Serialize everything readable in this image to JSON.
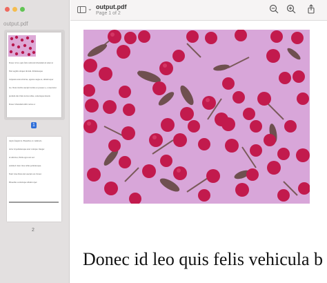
{
  "window": {
    "title": "output.pdf",
    "subtitle": "Page 1 of 2"
  },
  "sidebar": {
    "title": "output.pdf",
    "selected_page_label": "1",
    "page2_label": "2",
    "thumb1_lines": [
      "Donec id leo quis felis vehicula bibendum sit amet ut",
      "Nisl sagittis aliquet dictum. Pellentesque",
      "vulputate ante ultricies, egestas augue et, ullamcorper",
      "leo. Nunc mollis suscipit lacinia at posuere a, consectetur",
      "pretium dui. Duis lectus tellus, scelerisque mauris",
      "Donec bibendum nibh varius ac"
    ],
    "thumb2_lines": [
      "turpis feugiat in. Phasellus at commodo",
      "dolor id pellentesque ante volutpat. Integer",
      "ut ultricies, Nulla eget erat sed",
      "euismod risus vitae tellus pellentesque.",
      "Nam vitae Duis nisi suscipit est. Donec",
      "Phasellus scelerisque ullamcorper"
    ]
  },
  "toolbar": {
    "icons": [
      "sidebar-icon",
      "chevron-down-icon",
      "zoom-out-icon",
      "zoom-in-icon",
      "share-icon"
    ]
  },
  "document": {
    "image_description_color": "#d8a6d9",
    "body_text": "Donec id leo quis felis vehicula b"
  }
}
